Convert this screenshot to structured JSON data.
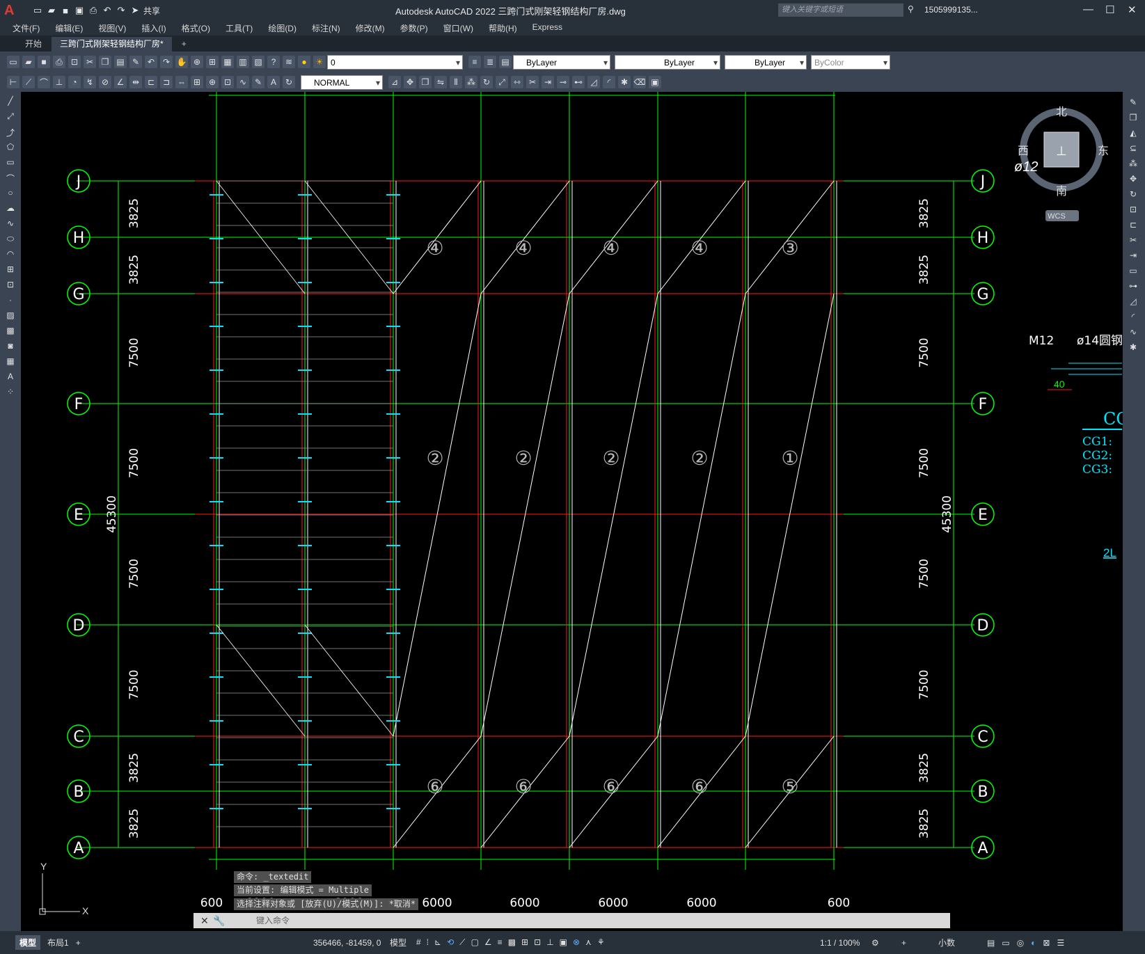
{
  "app": {
    "title": "Autodesk AutoCAD 2022    三跨门式刚架轻钢结构厂房.dwg",
    "share_label": "共享",
    "search_placeholder": "键入关键字或短语",
    "user": "1505999135..."
  },
  "menu": [
    "文件(F)",
    "编辑(E)",
    "视图(V)",
    "插入(I)",
    "格式(O)",
    "工具(T)",
    "绘图(D)",
    "标注(N)",
    "修改(M)",
    "参数(P)",
    "窗口(W)",
    "帮助(H)",
    "Express"
  ],
  "tabs": [
    {
      "label": "开始"
    },
    {
      "label": "三跨门式刚架轻钢结构厂房*"
    }
  ],
  "toolbar": {
    "layer": "0",
    "color": "ByLayer",
    "linetype": "ByLayer",
    "lineweight": "ByLayer",
    "plotstyle": "ByColor",
    "dimstyle": "NORMAL"
  },
  "viewcube": {
    "north": "北",
    "south": "南",
    "east": "东",
    "west": "西",
    "wcs": "WCS",
    "dia": "ø12"
  },
  "drawing": {
    "grid_rows": [
      "J",
      "H",
      "G",
      "F",
      "E",
      "D",
      "C",
      "B",
      "A"
    ],
    "left_dims": [
      "3825",
      "3825",
      "7500",
      "7500",
      "7500",
      "7500",
      "3825",
      "3825"
    ],
    "total_dim": "45300",
    "bottom_dims": [
      "600",
      "6000",
      "6000",
      "6000",
      "6000",
      "6000",
      "6000",
      "600"
    ],
    "bay_labels_top": [
      "④",
      "④",
      "④",
      "④",
      "③"
    ],
    "bay_labels_mid": [
      "②",
      "②",
      "②",
      "②",
      "①"
    ],
    "bay_labels_bot": [
      "⑥",
      "⑥",
      "⑥",
      "⑥",
      "⑤"
    ],
    "detail": {
      "m12": "M12",
      "rod": "ø14圆钢",
      "dim": "40",
      "cg": "CG",
      "cg1": "CG1:",
      "cg2": "CG2:",
      "cg3": "CG3:",
      "note": "2L"
    }
  },
  "command_history": [
    "命令: _textedit",
    "当前设置: 编辑模式 = Multiple",
    "选择注释对象或 [放弃(U)/模式(M)]: *取消*"
  ],
  "command_placeholder": "键入命令",
  "status": {
    "layout_tabs": [
      "模型",
      "布局1"
    ],
    "coords": "356466, -81459, 0",
    "model": "模型",
    "scale": "1:1 / 100%",
    "units": "小数"
  },
  "colors": {
    "grid_green": "#00ff00",
    "red_line": "#ff1a1a",
    "cyan": "#00e5ff",
    "white": "#ffffff"
  }
}
